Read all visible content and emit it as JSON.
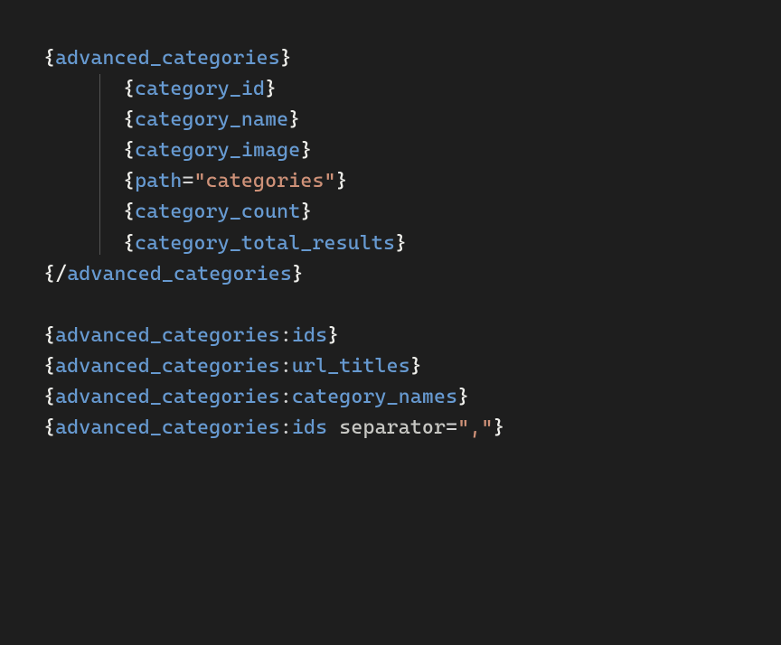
{
  "lines": [
    {
      "indent": 0,
      "tokens": [
        {
          "type": "brace",
          "text": "{"
        },
        {
          "type": "tag",
          "text": "advanced_categories"
        },
        {
          "type": "brace",
          "text": "}"
        }
      ]
    },
    {
      "indent": 1,
      "tokens": [
        {
          "type": "brace",
          "text": "{"
        },
        {
          "type": "tag",
          "text": "category_id"
        },
        {
          "type": "brace",
          "text": "}"
        }
      ]
    },
    {
      "indent": 1,
      "tokens": [
        {
          "type": "brace",
          "text": "{"
        },
        {
          "type": "tag",
          "text": "category_name"
        },
        {
          "type": "brace",
          "text": "}"
        }
      ]
    },
    {
      "indent": 1,
      "tokens": [
        {
          "type": "brace",
          "text": "{"
        },
        {
          "type": "tag",
          "text": "category_image"
        },
        {
          "type": "brace",
          "text": "}"
        }
      ]
    },
    {
      "indent": 1,
      "tokens": [
        {
          "type": "brace",
          "text": "{"
        },
        {
          "type": "tag",
          "text": "path"
        },
        {
          "type": "eq",
          "text": "="
        },
        {
          "type": "str",
          "text": "\"categories\""
        },
        {
          "type": "brace",
          "text": "}"
        }
      ]
    },
    {
      "indent": 1,
      "tokens": [
        {
          "type": "brace",
          "text": "{"
        },
        {
          "type": "tag",
          "text": "category_count"
        },
        {
          "type": "brace",
          "text": "}"
        }
      ]
    },
    {
      "indent": 1,
      "tokens": [
        {
          "type": "brace",
          "text": "{"
        },
        {
          "type": "tag",
          "text": "category_total_results"
        },
        {
          "type": "brace",
          "text": "}"
        }
      ]
    },
    {
      "indent": 0,
      "tokens": [
        {
          "type": "brace",
          "text": "{"
        },
        {
          "type": "slash",
          "text": "/"
        },
        {
          "type": "tag",
          "text": "advanced_categories"
        },
        {
          "type": "brace",
          "text": "}"
        }
      ]
    },
    {
      "blank": true
    },
    {
      "indent": 0,
      "tokens": [
        {
          "type": "brace",
          "text": "{"
        },
        {
          "type": "tag",
          "text": "advanced_categories"
        },
        {
          "type": "colon",
          "text": ":"
        },
        {
          "type": "modifier",
          "text": "ids"
        },
        {
          "type": "brace",
          "text": "}"
        }
      ]
    },
    {
      "indent": 0,
      "tokens": [
        {
          "type": "brace",
          "text": "{"
        },
        {
          "type": "tag",
          "text": "advanced_categories"
        },
        {
          "type": "colon",
          "text": ":"
        },
        {
          "type": "modifier",
          "text": "url_titles"
        },
        {
          "type": "brace",
          "text": "}"
        }
      ]
    },
    {
      "indent": 0,
      "tokens": [
        {
          "type": "brace",
          "text": "{"
        },
        {
          "type": "tag",
          "text": "advanced_categories"
        },
        {
          "type": "colon",
          "text": ":"
        },
        {
          "type": "modifier",
          "text": "category_names"
        },
        {
          "type": "brace",
          "text": "}"
        }
      ]
    },
    {
      "indent": 0,
      "tokens": [
        {
          "type": "brace",
          "text": "{"
        },
        {
          "type": "tag",
          "text": "advanced_categories"
        },
        {
          "type": "colon",
          "text": ":"
        },
        {
          "type": "modifier",
          "text": "ids"
        },
        {
          "type": "space",
          "text": " "
        },
        {
          "type": "attrname2",
          "text": "separator"
        },
        {
          "type": "eq",
          "text": "="
        },
        {
          "type": "str",
          "text": "\",\""
        },
        {
          "type": "brace",
          "text": "}"
        }
      ]
    }
  ]
}
